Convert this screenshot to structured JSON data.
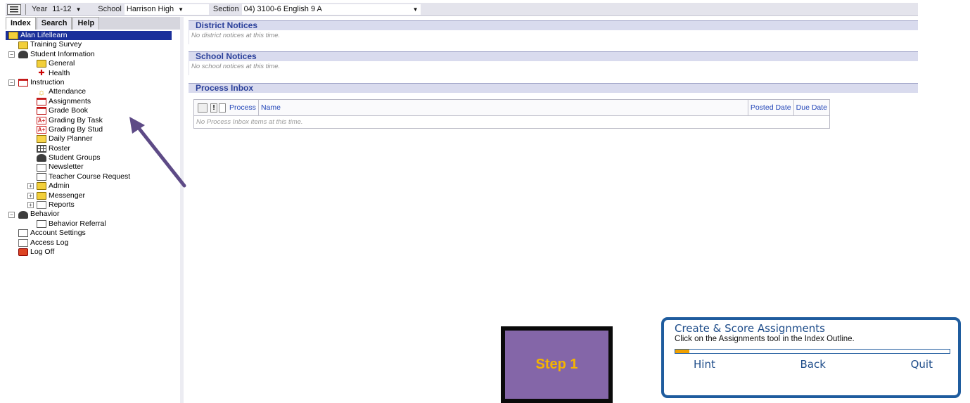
{
  "toolbar": {
    "year_label": "Year",
    "year_value": "11-12",
    "school_label": "School",
    "school_value": "Harrison High",
    "section_label": "Section",
    "section_value": "04) 3100-6 English 9 A"
  },
  "tabs": [
    {
      "label": "Index"
    },
    {
      "label": "Search"
    },
    {
      "label": "Help"
    }
  ],
  "tree": {
    "user": "Alan Lifellearn",
    "training_survey": "Training Survey",
    "student_information": "Student Information",
    "general": "General",
    "health": "Health",
    "instruction": "Instruction",
    "attendance": "Attendance",
    "assignments": "Assignments",
    "grade_book": "Grade Book",
    "grading_by_task": "Grading By Task",
    "grading_by_student": "Grading By Stud",
    "daily_planner": "Daily Planner",
    "roster": "Roster",
    "student_groups": "Student Groups",
    "newsletter": "Newsletter",
    "teacher_course_requests": "Teacher Course Request",
    "admin": "Admin",
    "messenger": "Messenger",
    "reports": "Reports",
    "behavior": "Behavior",
    "behavior_referral": "Behavior Referral",
    "account_settings": "Account Settings",
    "access_log": "Access Log",
    "log_off": "Log Off"
  },
  "district_notices": {
    "title": "District Notices",
    "empty": "No district notices at this time."
  },
  "school_notices": {
    "title": "School Notices",
    "empty": "No school notices at this time."
  },
  "process_inbox": {
    "title": "Process Inbox",
    "columns": {
      "process": "Process",
      "name": "Name",
      "posted_date": "Posted Date",
      "due_date": "Due Date"
    },
    "empty": "No Process Inbox items at this time."
  },
  "step": {
    "label": "Step 1"
  },
  "tutorial": {
    "title": "Create & Score Assignments",
    "instruction": "Click on the Assignments tool in the Index Outline.",
    "progress_fraction": 0.05,
    "hint": "Hint",
    "back": "Back",
    "quit": "Quit"
  },
  "colors": {
    "header_text": "#2a3f9a",
    "step_box": "#8466a8",
    "step_text": "#f4b400",
    "tutorial_border": "#1f5c9e",
    "arrow": "#5d4a86"
  },
  "icons": {
    "menu": "menu-icon",
    "user": "user-icon",
    "folder": "folder-icon"
  }
}
